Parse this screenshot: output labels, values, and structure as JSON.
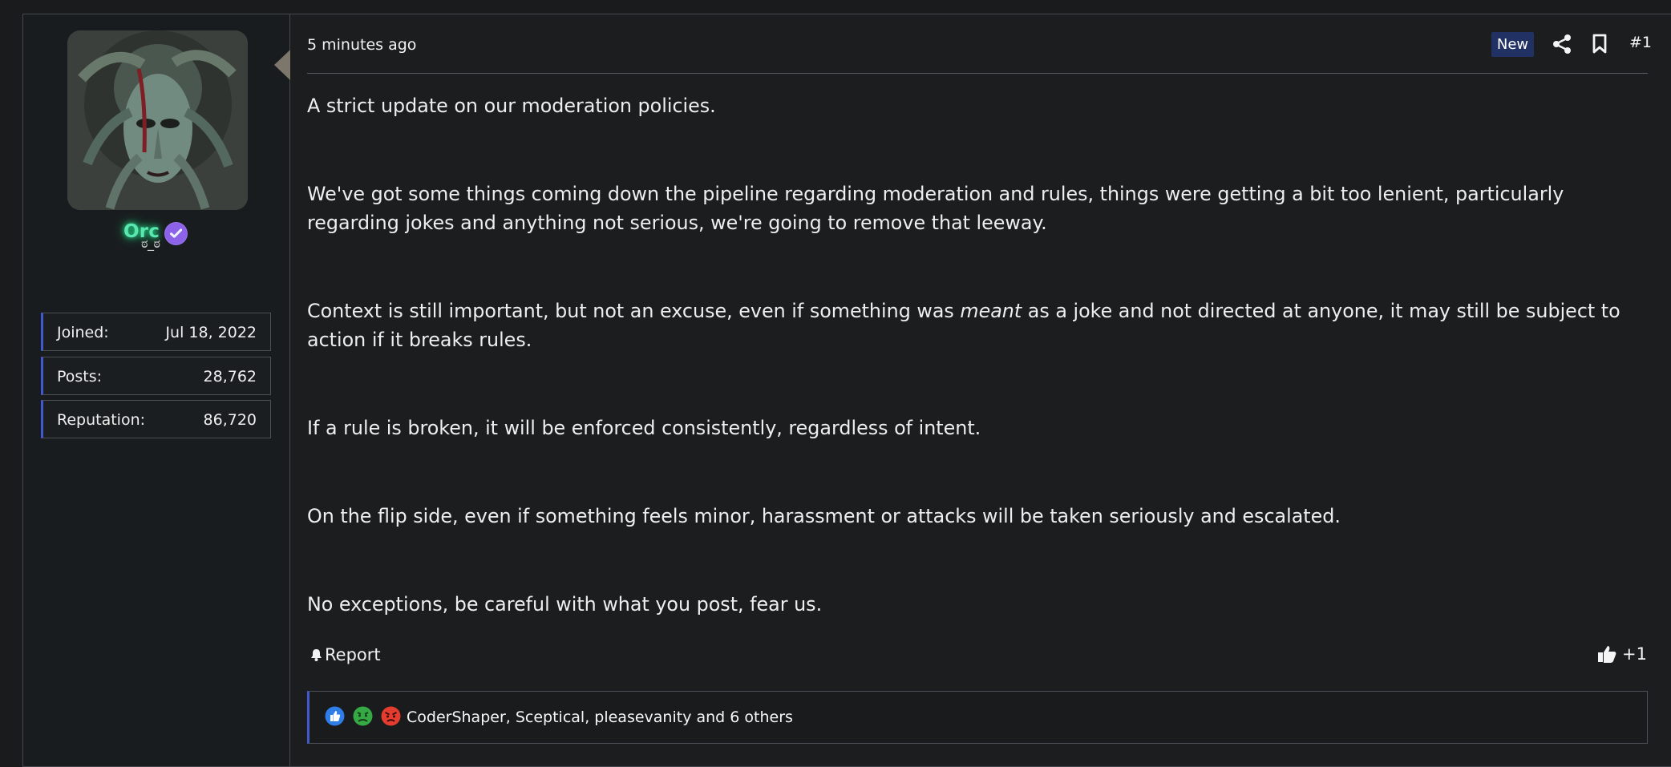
{
  "user": {
    "name": "Orc",
    "title": "ಠ_ಠ",
    "stats": [
      {
        "label": "Joined:",
        "value": "Jul 18, 2022"
      },
      {
        "label": "Posts:",
        "value": "28,762"
      },
      {
        "label": "Reputation:",
        "value": "86,720"
      }
    ]
  },
  "post": {
    "time": "5 minutes ago",
    "badge": "New",
    "number": "#1",
    "paragraphs": [
      "A strict update on our moderation policies.",
      "We've got some things coming down the pipeline regarding moderation and rules, things were getting a bit too lenient, particularly regarding jokes and anything not serious, we're going to remove that leeway.",
      {
        "before": "Context is still important, but not an excuse, even if something was ",
        "em": "meant",
        "after": " as a joke and not directed at anyone, it may still be subject to action if it breaks rules."
      },
      "If a rule is broken, it will be enforced consistently, regardless of intent.",
      "On the flip side, even if something feels minor, harassment or attacks will be taken seriously and escalated.",
      "No exceptions, be careful with what you post, fear us."
    ],
    "report_label": "Report",
    "like_count": "+1",
    "reactions_text": "CoderShaper, Sceptical, pleasevanity and 6 others"
  },
  "icons": {
    "share": "share-icon",
    "bookmark": "bookmark-icon",
    "report": "bell-icon",
    "like": "thumbs-up-icon",
    "reaction_like": "like-reaction-icon",
    "reaction_sick": "sick-reaction-icon",
    "reaction_angry": "angry-reaction-icon"
  },
  "colors": {
    "username_glow": "#59e7b0",
    "badge_bg": "#223163",
    "accent_border": "#4258cf",
    "verified": "#8c62e8"
  }
}
